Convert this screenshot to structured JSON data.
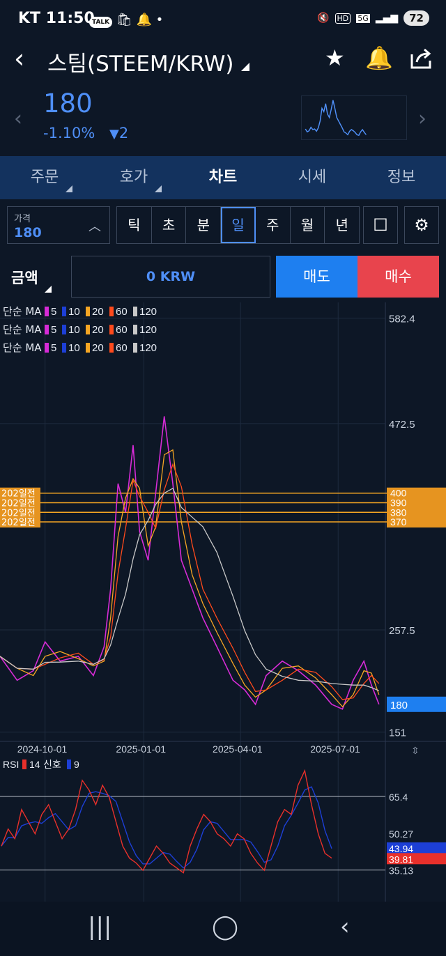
{
  "status": {
    "carrier": "KT",
    "time": "11:50",
    "talk_badge": "TALK",
    "hd_label": "HD",
    "network_label": "5G",
    "battery": "72"
  },
  "header": {
    "title": "스팀(STEEM/KRW)"
  },
  "quote": {
    "price": "180",
    "change_pct": "-1.10%",
    "change_abs": "2"
  },
  "tabs": [
    {
      "label": "주문"
    },
    {
      "label": "호가"
    },
    {
      "label": "차트"
    },
    {
      "label": "시세"
    },
    {
      "label": "정보"
    }
  ],
  "controls": {
    "price_label": "가격",
    "price_value": "180",
    "periods": [
      "틱",
      "초",
      "분",
      "일",
      "주",
      "월",
      "년"
    ],
    "active_period": "일"
  },
  "order": {
    "amount_label": "금액",
    "amount_value": "0 KRW",
    "sell_label": "매도",
    "buy_label": "매수"
  },
  "legend": {
    "prefix": "단순 MA",
    "items": [
      {
        "label": "5",
        "color": "#d62bd6"
      },
      {
        "label": "10",
        "color": "#1d3fd6"
      },
      {
        "label": "20",
        "color": "#f5a623"
      },
      {
        "label": "60",
        "color": "#ff4a1c"
      },
      {
        "label": "120",
        "color": "#c8c8c8"
      }
    ]
  },
  "colors": {
    "accent": "#4f8ff7",
    "sell": "#1e7ff0",
    "buy": "#e8444d",
    "tab_bar": "#13325e",
    "alert_line": "#f5a623"
  },
  "chart_data": {
    "type": "line",
    "x_ticks": [
      "2024-10-01",
      "2025-01-01",
      "2025-04-01",
      "2025-07-01"
    ],
    "y_ticks": [
      582.4,
      472.5,
      257.5,
      151
    ],
    "ylim": [
      145,
      590
    ],
    "current_price": 180,
    "alert_lines": [
      {
        "label": "202일전",
        "value": 400
      },
      {
        "label": "202일전",
        "value": 390
      },
      {
        "label": "202일전",
        "value": 380
      },
      {
        "label": "202일전",
        "value": 370
      }
    ],
    "price_series_approx": [
      [
        "2024-08-20",
        230
      ],
      [
        "2024-09-05",
        205
      ],
      [
        "2024-09-20",
        215
      ],
      [
        "2024-10-01",
        245
      ],
      [
        "2024-10-15",
        225
      ],
      [
        "2024-11-01",
        230
      ],
      [
        "2024-11-15",
        210
      ],
      [
        "2024-11-25",
        240
      ],
      [
        "2024-12-01",
        300
      ],
      [
        "2024-12-08",
        410
      ],
      [
        "2024-12-15",
        380
      ],
      [
        "2024-12-22",
        450
      ],
      [
        "2024-12-28",
        360
      ],
      [
        "2025-01-05",
        330
      ],
      [
        "2025-01-12",
        400
      ],
      [
        "2025-01-20",
        480
      ],
      [
        "2025-01-28",
        410
      ],
      [
        "2025-02-05",
        330
      ],
      [
        "2025-02-15",
        300
      ],
      [
        "2025-02-25",
        270
      ],
      [
        "2025-03-10",
        240
      ],
      [
        "2025-03-25",
        205
      ],
      [
        "2025-04-05",
        195
      ],
      [
        "2025-04-15",
        180
      ],
      [
        "2025-04-25",
        210
      ],
      [
        "2025-05-10",
        225
      ],
      [
        "2025-05-25",
        215
      ],
      [
        "2025-06-10",
        200
      ],
      [
        "2025-06-25",
        180
      ],
      [
        "2025-07-05",
        175
      ],
      [
        "2025-07-15",
        205
      ],
      [
        "2025-07-25",
        225
      ],
      [
        "2025-08-01",
        200
      ],
      [
        "2025-08-08",
        180
      ]
    ],
    "rsi": {
      "label": "RSI",
      "period_label": "14",
      "signal_label": "신호",
      "signal_period": "9",
      "levels": [
        65.4,
        50.27,
        35.13
      ],
      "rsi_value": 39.81,
      "signal_value": 43.94,
      "rsi_color": "#e8302b",
      "signal_color": "#1d3fd6",
      "ylim": [
        25,
        80
      ],
      "rsi_series_approx": [
        45,
        52,
        48,
        60,
        55,
        50,
        58,
        62,
        55,
        48,
        52,
        60,
        72,
        68,
        62,
        70,
        65,
        55,
        45,
        40,
        38,
        35,
        40,
        45,
        42,
        38,
        36,
        34,
        45,
        52,
        58,
        55,
        50,
        48,
        45,
        50,
        48,
        42,
        38,
        35,
        45,
        55,
        60,
        58,
        70,
        76,
        62,
        50,
        42,
        40
      ]
    }
  }
}
